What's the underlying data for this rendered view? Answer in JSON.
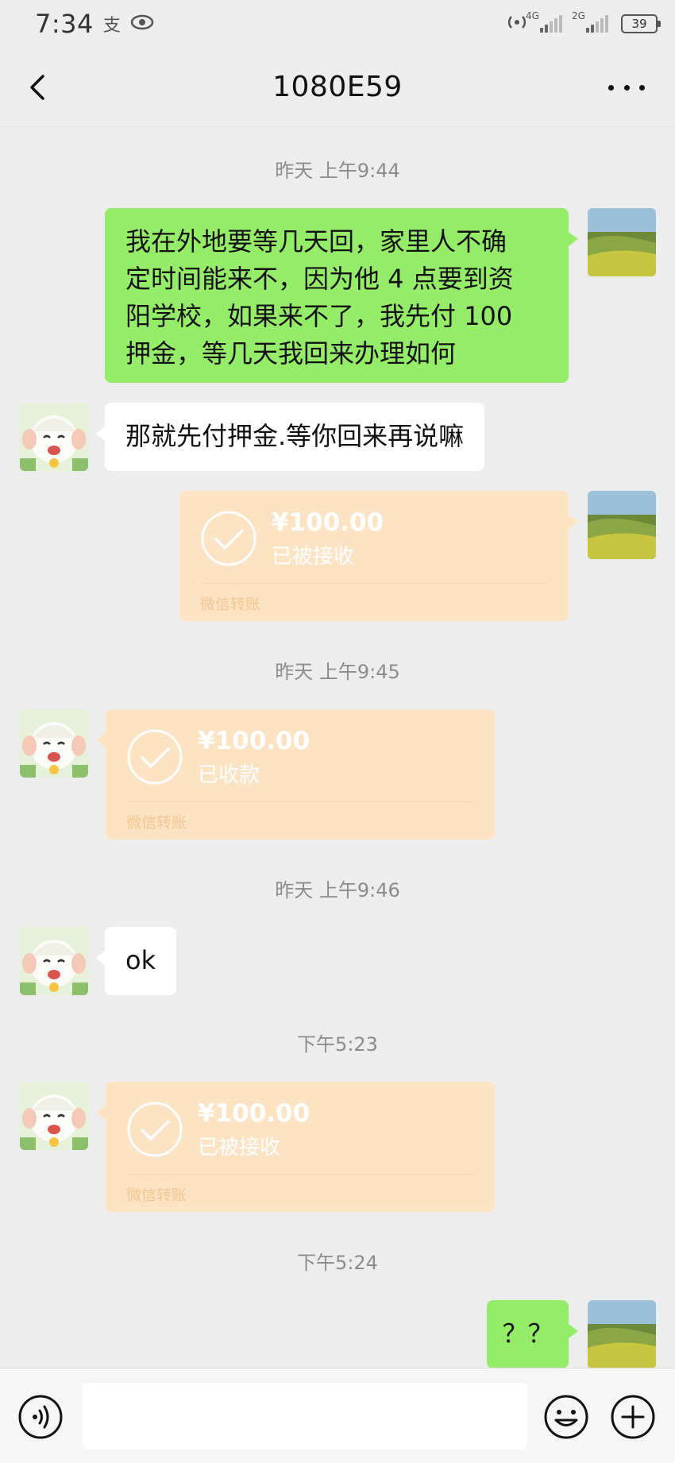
{
  "status_bar": {
    "time": "7:34",
    "alipay_glyph": "支",
    "eye_icon": "eye-icon",
    "sim1_label": "4G",
    "sim2_label": "2G",
    "battery": "39"
  },
  "nav": {
    "title": "1080E59",
    "back_icon": "chevron-left-icon",
    "more_icon": "more-dots-icon"
  },
  "messages": [
    {
      "kind": "timestamp",
      "text": "昨天 上午9:44"
    },
    {
      "kind": "text",
      "from": "me",
      "lines": [
        "我在外地要等几天回，家里人不确",
        "定时间能来不，因为他 4 点要到资",
        "阳学校，如果来不了，我先付 100",
        "押金，等几天我回来办理如何"
      ]
    },
    {
      "kind": "text",
      "from": "them",
      "text": "那就先付押金.等你回来再说嘛"
    },
    {
      "kind": "transfer",
      "from": "me",
      "amount": "¥100.00",
      "status": "已被接收",
      "label": "微信转账"
    },
    {
      "kind": "timestamp",
      "text": "昨天 上午9:45"
    },
    {
      "kind": "transfer",
      "from": "them",
      "amount": "¥100.00",
      "status": "已收款",
      "label": "微信转账"
    },
    {
      "kind": "timestamp",
      "text": "昨天 上午9:46"
    },
    {
      "kind": "text",
      "from": "them",
      "text": "ok"
    },
    {
      "kind": "timestamp",
      "text": "下午5:23"
    },
    {
      "kind": "transfer",
      "from": "them",
      "amount": "¥100.00",
      "status": "已被接收",
      "label": "微信转账"
    },
    {
      "kind": "timestamp",
      "text": "下午5:24"
    },
    {
      "kind": "text",
      "from": "me",
      "text": "？？"
    }
  ],
  "input_bar": {
    "voice_icon": "voice-icon",
    "emoji_icon": "emoji-icon",
    "plus_icon": "plus-icon",
    "placeholder": ""
  },
  "colors": {
    "background": "#ededed",
    "my_bubble": "#95ec69",
    "their_bubble": "#ffffff",
    "transfer_card": "#fce3c3"
  }
}
